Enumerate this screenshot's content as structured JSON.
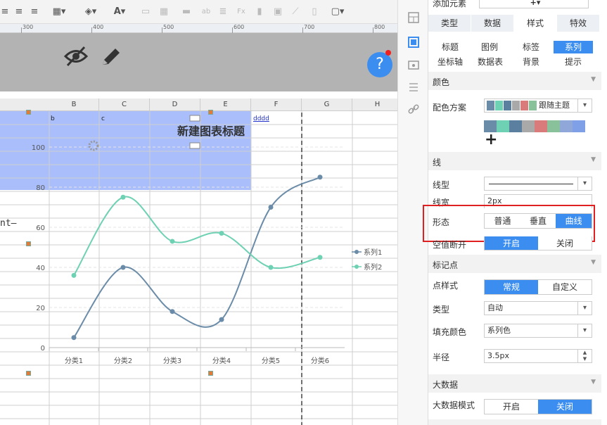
{
  "ruler": {
    "ticks": [
      "300",
      "400",
      "500",
      "600",
      "700",
      "800"
    ]
  },
  "columns": [
    "B",
    "C",
    "D",
    "E",
    "F",
    "G",
    "H"
  ],
  "cells": {
    "b": "b",
    "c": "c",
    "f": "dddd"
  },
  "left_stub": "nt–",
  "help": {
    "label": "?"
  },
  "chart_data": {
    "type": "line",
    "title": "新建图表标题",
    "categories": [
      "分类1",
      "分类2",
      "分类3",
      "分类4",
      "分类5",
      "分类6"
    ],
    "series": [
      {
        "name": "系列1",
        "values": [
          5,
          40,
          18,
          14,
          70,
          85
        ],
        "color": "#6b8ca8"
      },
      {
        "name": "系列2",
        "values": [
          36,
          75,
          53,
          57,
          40,
          45
        ],
        "color": "#6fd1b3"
      }
    ],
    "ylim": [
      0,
      100
    ],
    "yticks": [
      "0",
      "20",
      "40",
      "60",
      "80",
      "100"
    ],
    "smooth": true,
    "legend_position": "right"
  },
  "panel": {
    "top_label": "添加元素",
    "tabs": [
      "类型",
      "数据",
      "样式",
      "特效"
    ],
    "subtabs_row1": [
      "标题",
      "图例",
      "标签",
      "系列"
    ],
    "subtabs_row2": [
      "坐标轴",
      "数据表",
      "背景",
      "提示"
    ],
    "color_section": "颜色",
    "scheme_label": "配色方案",
    "scheme_value": "跟随主题",
    "palette": [
      "#6b8ca8",
      "#6fd1b3",
      "#5b7f9f",
      "#a9a9a9",
      "#d97b7b",
      "#89c19b",
      "#8fa7d9",
      "#7fa0e6"
    ],
    "line_section": "线",
    "line_type_label": "线型",
    "line_width_label": "线宽",
    "line_width_value": "2px",
    "shape_label": "形态",
    "shape_options": [
      "普通",
      "垂直",
      "曲线"
    ],
    "null_label": "空值断开",
    "null_options": [
      "开启",
      "关闭"
    ],
    "marker_section": "标记点",
    "marker_style_label": "点样式",
    "marker_style_options": [
      "常规",
      "自定义"
    ],
    "type_label": "类型",
    "type_value": "自动",
    "fill_label": "填充颜色",
    "fill_value": "系列色",
    "radius_label": "半径",
    "radius_value": "3.5px",
    "bigdata_section": "大数据",
    "bigdata_label": "大数据模式",
    "bigdata_options": [
      "开启",
      "关闭"
    ],
    "accent": "#3b8ef0",
    "highlight": "#e02020"
  }
}
